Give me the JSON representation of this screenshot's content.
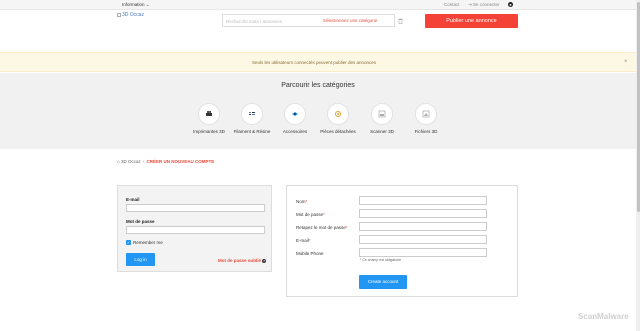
{
  "topbar": {
    "information": "Information",
    "contact": "Contact",
    "login": "Se connecter"
  },
  "header": {
    "logo_alt": "3D Occaz",
    "search_placeholder": "Recherche mots / annonces",
    "category_select": "Sélectionnez une catégorie",
    "publish_button": "Publier une annonce"
  },
  "alert": {
    "message": "Seuls les utilisateurs connectés peuvent publier des annonces",
    "close": "×"
  },
  "categories": {
    "title": "Parcourir les catégories",
    "items": [
      {
        "label": "Imprimantes 3D",
        "icon": "printer-icon"
      },
      {
        "label": "Filament & Résine",
        "icon": "filament-icon"
      },
      {
        "label": "Accessoires",
        "icon": "accessories-icon"
      },
      {
        "label": "Pièces détachées",
        "icon": "parts-icon"
      },
      {
        "label": "Scanner 3D",
        "icon": "scanner-icon"
      },
      {
        "label": "Fichiers 3D",
        "icon": "files-icon"
      }
    ]
  },
  "breadcrumb": {
    "home": "3D Occaz",
    "separator": "/",
    "current": "CRÉER UN NOUVEAU COMPTE"
  },
  "login_form": {
    "email_label": "E-mail",
    "password_label": "Mot de passe",
    "remember_label": "Remember me",
    "login_button": "Log in",
    "forgot_link": "Mot de passe oublié"
  },
  "register_form": {
    "fields": [
      {
        "label": "Nom",
        "required": true
      },
      {
        "label": "Mot de passe",
        "required": true
      },
      {
        "label": "Retapez le mot de passe",
        "required": true
      },
      {
        "label": "E-mail",
        "required": true
      },
      {
        "label": "Mobile Phone",
        "required": false
      }
    ],
    "required_note": "* Ce champ est obligatoire",
    "create_button": "Create account"
  },
  "watermark": "ScanMalware",
  "colors": {
    "accent_red": "#f44336",
    "accent_blue": "#2196f3",
    "alert_bg": "#fcf8e3"
  }
}
